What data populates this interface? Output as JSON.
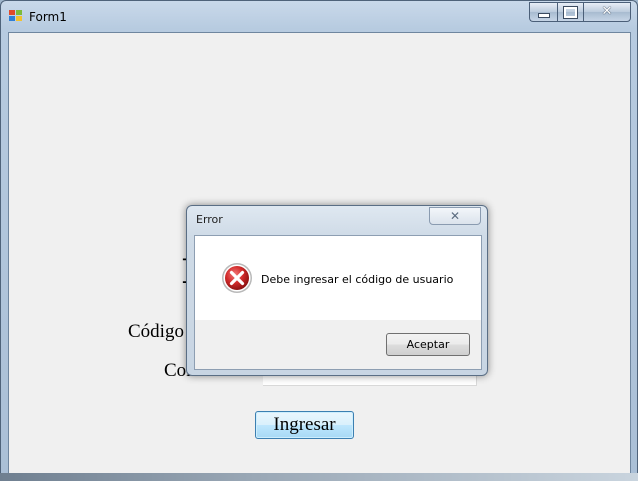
{
  "window": {
    "title": "Form1",
    "icon": "form-app-icon",
    "buttons": {
      "minimize": "minimize-icon",
      "maximize": "maximize-icon",
      "close": "close-icon",
      "close_glyph": "✕"
    }
  },
  "form": {
    "heading_partial": "I",
    "label_codigo": "Código",
    "label_contrasena_partial": "Con",
    "submit_label": "Ingresar"
  },
  "dialog": {
    "title": "Error",
    "close_glyph": "✕",
    "icon": "error-icon",
    "message": "Debe ingresar el código de usuario",
    "ok_label": "Aceptar"
  },
  "colors": {
    "error_red": "#c8282a",
    "button_focus_border": "#3c7fb1"
  }
}
